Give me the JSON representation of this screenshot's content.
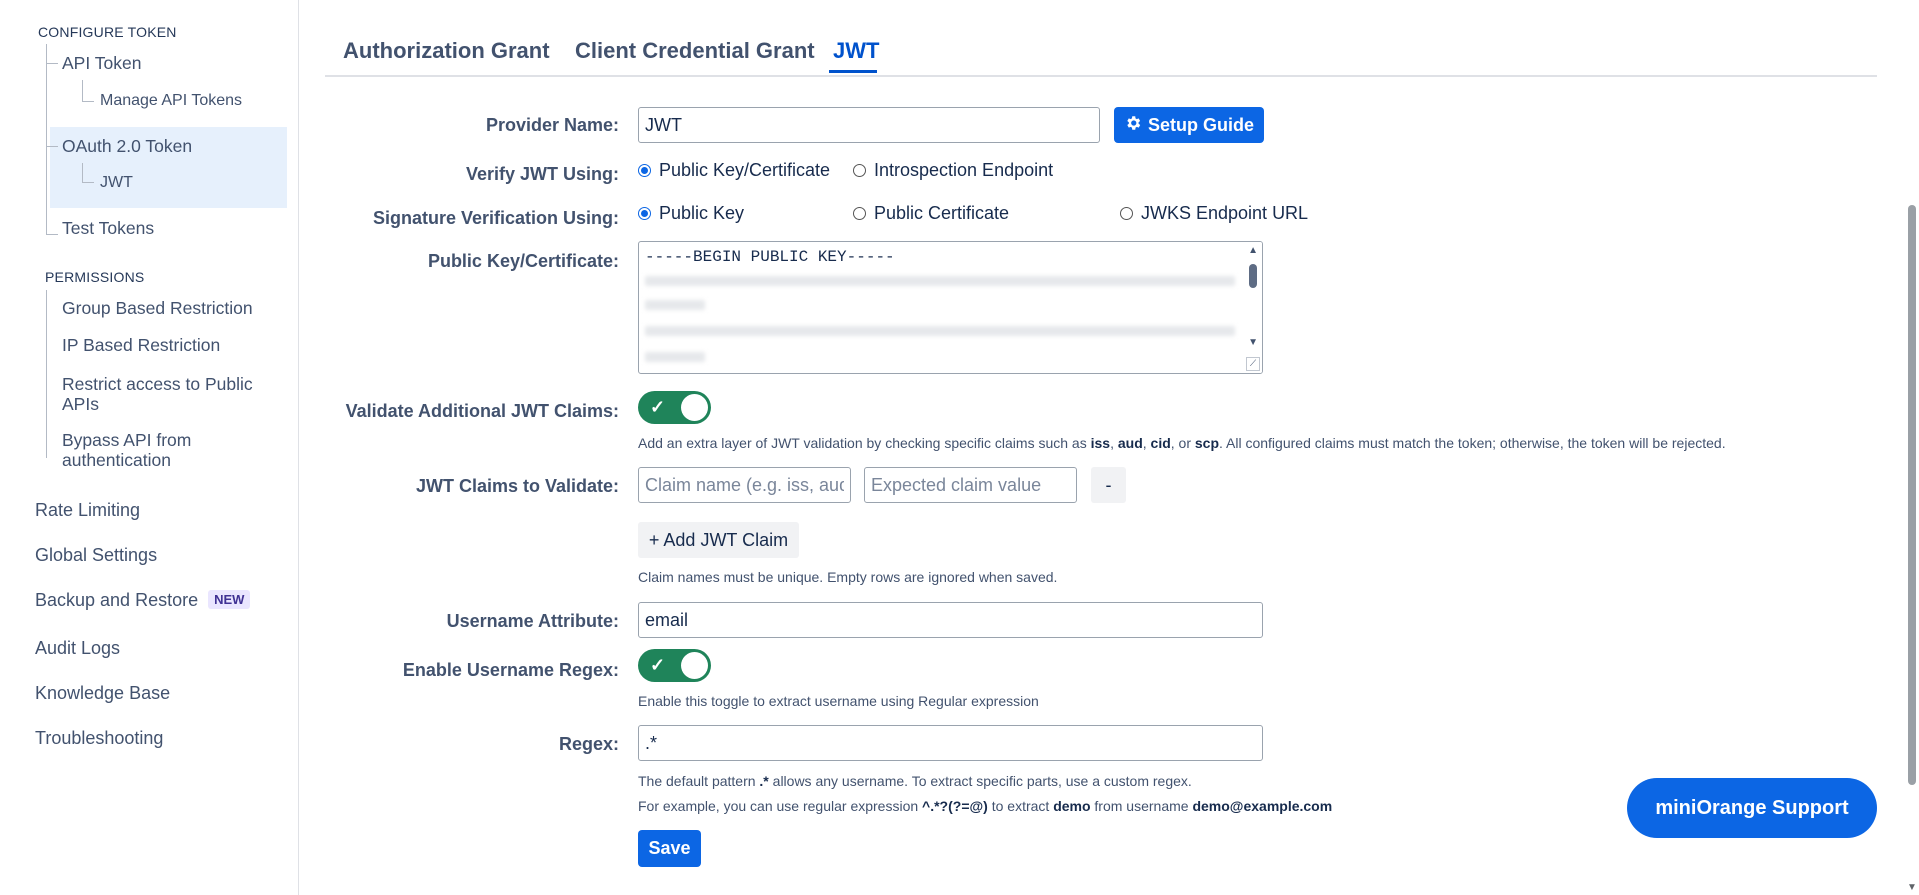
{
  "sidebar": {
    "configure_token_heading": "CONFIGURE TOKEN",
    "api_token": "API Token",
    "manage_api_tokens": "Manage API Tokens",
    "oauth_token": "OAuth 2.0 Token",
    "jwt": "JWT",
    "test_tokens": "Test Tokens",
    "permissions_heading": "PERMISSIONS",
    "group_restriction": "Group Based Restriction",
    "ip_restriction": "IP Based Restriction",
    "restrict_public_line1": "Restrict access to Public",
    "restrict_public_line2": "APIs",
    "bypass_line1": "Bypass API from",
    "bypass_line2": "authentication",
    "rate_limiting": "Rate Limiting",
    "global_settings": "Global Settings",
    "backup_restore": "Backup and Restore",
    "new_badge": "NEW",
    "audit_logs": "Audit Logs",
    "knowledge_base": "Knowledge Base",
    "troubleshooting": "Troubleshooting"
  },
  "tabs": {
    "authorization_grant": "Authorization Grant",
    "client_credential_grant": "Client Credential Grant",
    "jwt": "JWT"
  },
  "form": {
    "provider_name_label": "Provider Name:",
    "provider_name_value": "JWT",
    "setup_guide": "Setup Guide",
    "verify_jwt_label": "Verify JWT Using:",
    "verify_option_public_key_cert": "Public Key/Certificate",
    "verify_option_introspection": "Introspection Endpoint",
    "signature_label": "Signature Verification Using:",
    "sig_option_public_key": "Public Key",
    "sig_option_public_cert": "Public Certificate",
    "sig_option_jwks": "JWKS Endpoint URL",
    "public_key_label": "Public Key/Certificate:",
    "public_key_first_line": "-----BEGIN PUBLIC KEY-----",
    "validate_claims_label": "Validate Additional JWT Claims:",
    "validate_claims_help_1": "Add an extra layer of JWT validation by checking specific claims such as ",
    "claim_iss": "iss",
    "sep1": ", ",
    "claim_aud": "aud",
    "sep2": ", ",
    "claim_cid": "cid",
    "sep3": ", or ",
    "claim_scp": "scp",
    "validate_claims_help_2": ". All configured claims must match the token; otherwise, the token will be rejected.",
    "jwt_claims_label": "JWT Claims to Validate:",
    "claim_name_placeholder": "Claim name (e.g. iss, aud)",
    "claim_value_placeholder": "Expected claim value",
    "remove_claim": "-",
    "add_claim": "+ Add JWT Claim",
    "claims_help": "Claim names must be unique. Empty rows are ignored when saved.",
    "username_attr_label": "Username Attribute:",
    "username_attr_value": "email",
    "enable_regex_label": "Enable Username Regex:",
    "enable_regex_help": "Enable this toggle to extract username using Regular expression",
    "regex_label": "Regex:",
    "regex_value": ".*",
    "regex_help_1a": "The default pattern ",
    "regex_help_1b": ".*",
    "regex_help_1c": " allows any username. To extract specific parts, use a custom regex.",
    "regex_help_2a": "For example, you can use regular expression ",
    "regex_help_2b": "^.*?(?=@)",
    "regex_help_2c": " to extract ",
    "regex_help_2d": "demo",
    "regex_help_2e": " from username ",
    "regex_help_2f": "demo@example.com",
    "save": "Save"
  },
  "support_button": "miniOrange Support",
  "colors": {
    "accent": "#0c66e4",
    "toggle_on": "#1f845a",
    "selected_bg": "#e6f0fc"
  },
  "icons": {
    "setup_guide": "gear-icon",
    "toggle": "check-icon"
  }
}
